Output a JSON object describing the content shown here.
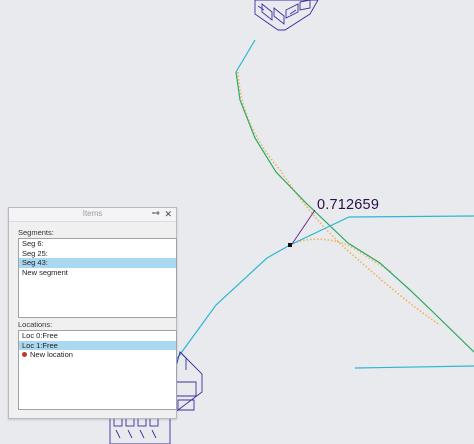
{
  "measurement": {
    "value_text": "0.712659"
  },
  "items_panel": {
    "title": "Items",
    "segments_label": "Segments:",
    "segments": [
      {
        "label": "Seg 6:",
        "selected": false
      },
      {
        "label": "Seg 25:",
        "selected": false
      },
      {
        "label": "Seg 43:",
        "selected": true
      },
      {
        "label": "New segment",
        "selected": false
      }
    ],
    "locations_label": "Locations:",
    "locations": [
      {
        "label": "Loc 0:Free",
        "selected": false,
        "marker": false
      },
      {
        "label": "Loc 1:Free",
        "selected": true,
        "marker": false
      },
      {
        "label": "New location",
        "selected": false,
        "marker": true
      }
    ]
  },
  "colors": {
    "background": "#e9eaed",
    "path_cyan": "#2bb7d6",
    "path_green": "#39a84a",
    "curve_dotted": "#f0b455",
    "connector_outline": "#3b2fa2",
    "measure_line": "#6a2c9a",
    "selection_blue": "#a9d8f0"
  },
  "icons": [
    "connector-icon",
    "pin-icon",
    "close-icon",
    "location-marker-icon"
  ]
}
